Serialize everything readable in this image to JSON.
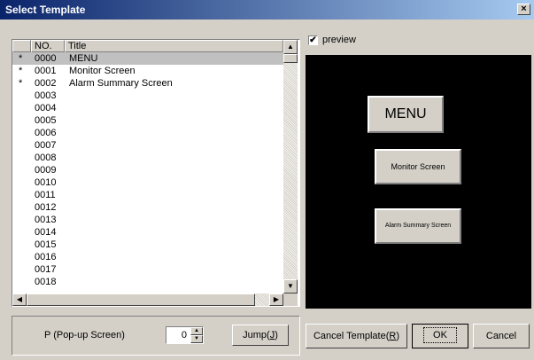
{
  "window": {
    "title": "Select Template",
    "close_icon": "×"
  },
  "list": {
    "columns": [
      " ",
      "NO.",
      "Title"
    ],
    "rows": [
      {
        "mark": "*",
        "no": "0000",
        "title": "MENU"
      },
      {
        "mark": "*",
        "no": "0001",
        "title": "Monitor Screen"
      },
      {
        "mark": "*",
        "no": "0002",
        "title": "Alarm Summary Screen"
      },
      {
        "mark": "",
        "no": "0003",
        "title": ""
      },
      {
        "mark": "",
        "no": "0004",
        "title": ""
      },
      {
        "mark": "",
        "no": "0005",
        "title": ""
      },
      {
        "mark": "",
        "no": "0006",
        "title": ""
      },
      {
        "mark": "",
        "no": "0007",
        "title": ""
      },
      {
        "mark": "",
        "no": "0008",
        "title": ""
      },
      {
        "mark": "",
        "no": "0009",
        "title": ""
      },
      {
        "mark": "",
        "no": "0010",
        "title": ""
      },
      {
        "mark": "",
        "no": "0011",
        "title": ""
      },
      {
        "mark": "",
        "no": "0012",
        "title": ""
      },
      {
        "mark": "",
        "no": "0013",
        "title": ""
      },
      {
        "mark": "",
        "no": "0014",
        "title": ""
      },
      {
        "mark": "",
        "no": "0015",
        "title": ""
      },
      {
        "mark": "",
        "no": "0016",
        "title": ""
      },
      {
        "mark": "",
        "no": "0017",
        "title": ""
      },
      {
        "mark": "",
        "no": "0018",
        "title": ""
      }
    ]
  },
  "preview": {
    "checkbox_label": "preview",
    "checked": true,
    "check_glyph": "✔",
    "buttons": [
      "MENU",
      "Monitor Screen",
      "Alarm Summary Screen"
    ]
  },
  "bottom": {
    "popup_label": "P (Pop-up Screen)",
    "spin_value": "0",
    "jump_label": "Jump(",
    "jump_key": "J",
    "jump_tail": ")",
    "cancel_template_label": "Cancel Template(",
    "cancel_template_key": "R",
    "cancel_template_tail": ")",
    "ok_label": "OK",
    "cancel_label": "Cancel"
  },
  "icons": {
    "scroll_up": "▲",
    "scroll_down": "▼",
    "scroll_left": "◀",
    "scroll_right": "▶",
    "spin_up": "▲",
    "spin_down": "▼"
  }
}
